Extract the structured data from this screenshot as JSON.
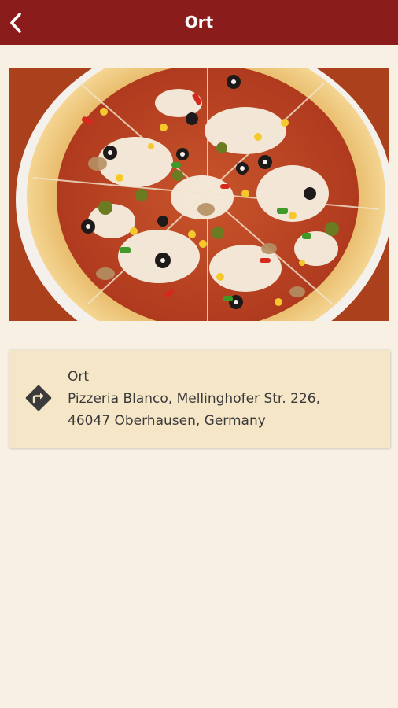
{
  "header": {
    "title": "Ort",
    "back_icon": "chevron-left-icon"
  },
  "hero_image": {
    "subject": "pizza"
  },
  "location_card": {
    "label": "Ort",
    "address_line1": "Pizzeria Blanco, Mellinghofer Str. 226,",
    "address_line2": "46047 Oberhausen, Germany",
    "icon": "directions-icon"
  },
  "colors": {
    "header_bg": "#8a1c1c",
    "page_bg": "#f8f0e3",
    "card_bg": "#f5e6c8",
    "text": "#3a3a3a",
    "icon": "#3b3b3b"
  }
}
